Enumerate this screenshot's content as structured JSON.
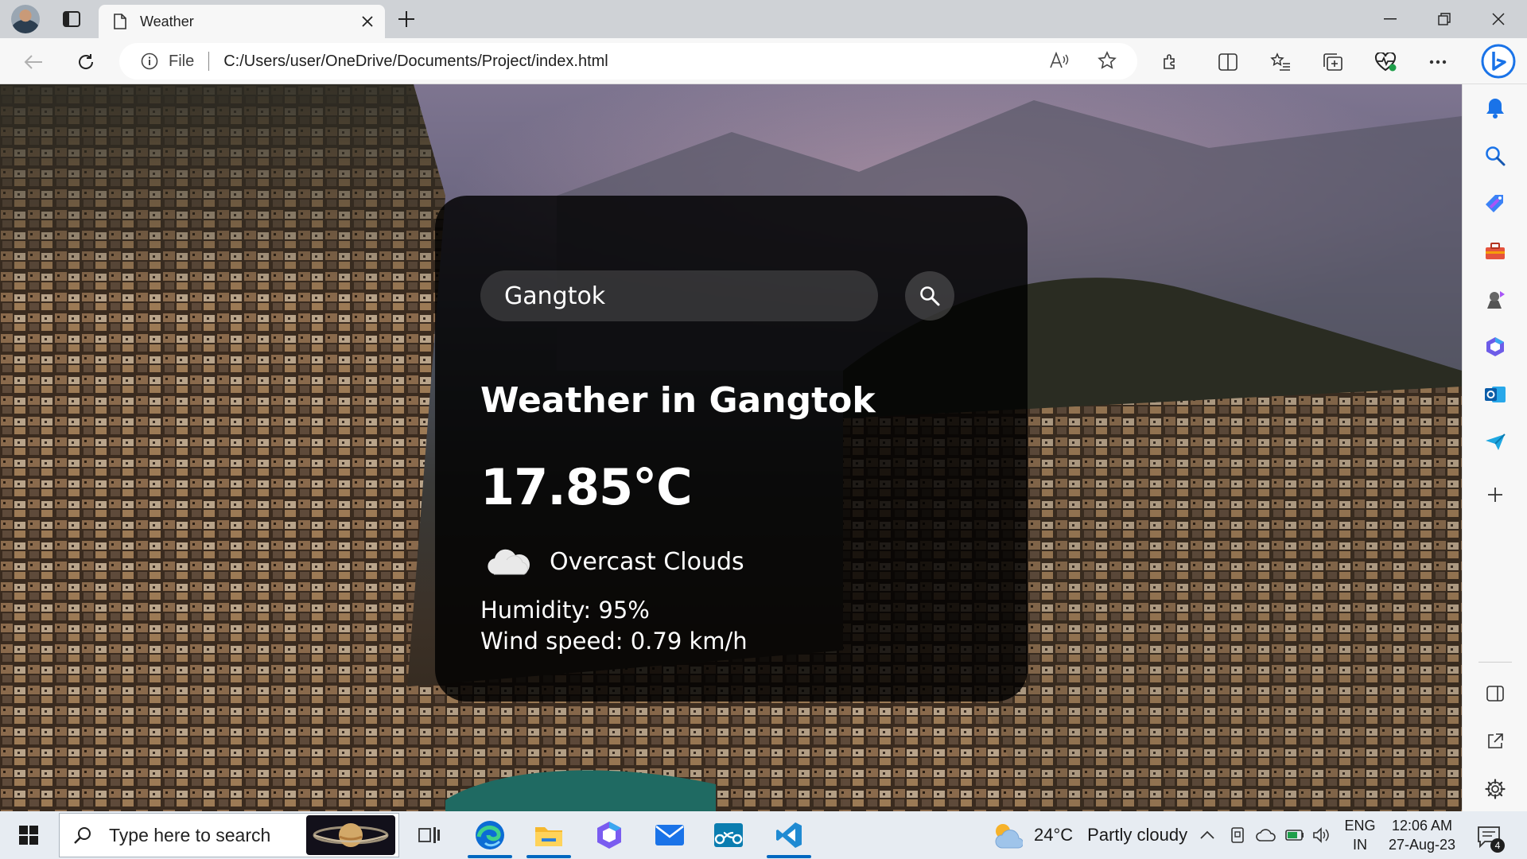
{
  "browser": {
    "tab_title": "Weather",
    "address_scheme": "File",
    "address_url": "C:/Users/user/OneDrive/Documents/Project/index.html"
  },
  "weather_app": {
    "search_value": "Gangtok",
    "heading": "Weather in Gangtok",
    "temperature": "17.85°C",
    "description": "Overcast Clouds",
    "humidity": "Humidity: 95%",
    "wind": "Wind speed: 0.79 km/h"
  },
  "taskbar": {
    "search_placeholder": "Type here to search",
    "weather_temp": "24°C",
    "weather_condition": "Partly cloudy",
    "language_line1": "ENG",
    "language_line2": "IN",
    "time": "12:06 AM",
    "date": "27-Aug-23",
    "notification_count": "4"
  },
  "colors": {
    "accent": "#0067c0",
    "card_bg": "#000000",
    "edge_blue": "#0c6cd4"
  },
  "icons": {
    "sidebar": [
      "bell-icon",
      "search-icon",
      "tag-icon",
      "toolbox-icon",
      "games-icon",
      "microsoft365-icon",
      "outlook-icon",
      "send-icon",
      "add-icon",
      "sidebar-toggle-icon",
      "external-link-icon",
      "settings-icon"
    ]
  }
}
